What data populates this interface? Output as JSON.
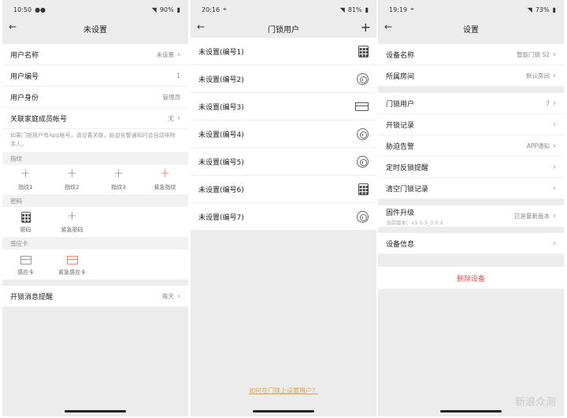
{
  "screen1": {
    "status": {
      "time": "10:50",
      "battery": "90%"
    },
    "title": "未设置",
    "rows": [
      {
        "label": "用户名称",
        "value": "未设置",
        "chevron": true
      },
      {
        "label": "用户编号",
        "value": "1",
        "chevron": false
      },
      {
        "label": "用户身份",
        "value": "管理员",
        "chevron": false
      },
      {
        "label": "关联家庭成员帐号",
        "value": "无",
        "chevron": true
      }
    ],
    "note": "如果门锁用户有App帐号，请设置关联，胁迫告警通知时会自动排除本人。",
    "fingerprint": {
      "section": "指纹",
      "items": [
        "指纹1",
        "指纹2",
        "指纹3",
        "紧急指纹"
      ]
    },
    "password": {
      "section": "密码",
      "items": [
        "密码",
        "紧急密码"
      ]
    },
    "card": {
      "section": "感应卡",
      "items": [
        "感应卡",
        "紧急感应卡"
      ]
    },
    "reminder": {
      "label": "开锁消息提醒",
      "value": "每天"
    }
  },
  "screen2": {
    "status": {
      "time": "20:16",
      "battery": "81%"
    },
    "title": "门锁用户",
    "users": [
      {
        "label": "未设置(编号1)",
        "icon": "keypad-icon"
      },
      {
        "label": "未设置(编号2)",
        "icon": "fingerprint-icon"
      },
      {
        "label": "未设置(编号3)",
        "icon": "card-icon"
      },
      {
        "label": "未设置(编号4)",
        "icon": "fingerprint-icon"
      },
      {
        "label": "未设置(编号5)",
        "icon": "fingerprint-icon"
      },
      {
        "label": "未设置(编号6)",
        "icon": "keypad-icon"
      },
      {
        "label": "未设置(编号7)",
        "icon": "fingerprint-icon"
      }
    ],
    "help_link": "如何在门锁上设置用户？"
  },
  "screen3": {
    "status": {
      "time": "19:19",
      "battery": "73%"
    },
    "title": "设置",
    "device_name": {
      "label": "设备名称",
      "value": "智能门锁 S2"
    },
    "room": {
      "label": "所属房间",
      "value": "默认房间"
    },
    "lock_users": {
      "label": "门锁用户",
      "value": "7"
    },
    "unlock_log": {
      "label": "开锁记录"
    },
    "duress": {
      "label": "胁迫告警",
      "value": "APP通知"
    },
    "timed_reminder": {
      "label": "定时反锁提醒"
    },
    "clear_log": {
      "label": "清空门锁记录"
    },
    "firmware": {
      "label": "固件升级",
      "current": "当前版本：v1.1.3_3.0.2",
      "value": "已是最新版本"
    },
    "device_info": {
      "label": "设备信息"
    },
    "delete": "删除设备"
  },
  "watermark": "新浪众测",
  "colors": {
    "background": "#ececec",
    "link": "#d9a441",
    "danger": "#d9534f",
    "accent_icon": "#d98a6a"
  }
}
